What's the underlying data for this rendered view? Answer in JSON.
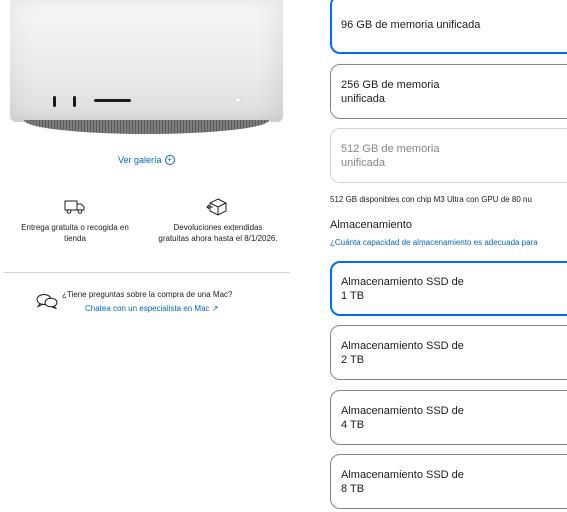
{
  "gallery": {
    "label": "Ver galería"
  },
  "features": {
    "delivery": "Entrega gratuita o recogida en tienda",
    "returns": "Devoluciones extendidas gratuitas ahora hasta el 8/1/2026."
  },
  "help": {
    "question": "¿Tiene preguntas sobre la compra de una Mac?",
    "link": "Chatea con un especialista en Mac ↗"
  },
  "memory": {
    "options": [
      {
        "label": "96 GB de memoria unificada",
        "state": "selected"
      },
      {
        "label": "256 GB de memoria unificada",
        "state": "available"
      },
      {
        "label": "512 GB de memoria unificada",
        "state": "disabled"
      }
    ],
    "note": "512 GB disponibles con chip M3 Ultra con GPU de 80 nu"
  },
  "storage": {
    "title": "Almacenamiento",
    "help_link": "¿Cuánta capacidad de almacenamiento es adecuada para",
    "options": [
      {
        "label": "Almacenamiento SSD de 1 TB",
        "state": "selected"
      },
      {
        "label": "Almacenamiento SSD de 2 TB",
        "state": "available"
      },
      {
        "label": "Almacenamiento SSD de 4 TB",
        "state": "available"
      },
      {
        "label": "Almacenamiento SSD de 8 TB",
        "state": "available"
      }
    ]
  },
  "colors": {
    "accent": "#0071e3",
    "link": "#0066cc",
    "text": "#1d1d1f",
    "disabled": "#86868b"
  }
}
